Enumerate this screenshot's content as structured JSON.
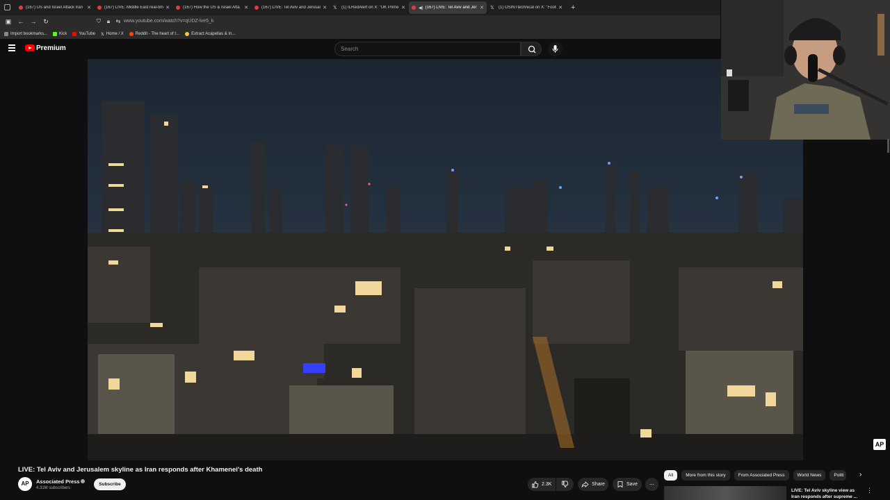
{
  "browser": {
    "tabs": [
      {
        "label": "(167) US and Israel Attack Iran",
        "active": false
      },
      {
        "label": "(167) LIVE: Middle East real-tim",
        "active": false
      },
      {
        "label": "(167) How the US & Israel Atta",
        "active": false
      },
      {
        "label": "(167) LIVE: Tel Aviv and Jerusale",
        "active": false
      },
      {
        "label": "(1) ILRedAlert on X: \"UK Prime",
        "active": false
      },
      {
        "label": "(167) LIVE: Tel Aviv and Jer",
        "active": true
      },
      {
        "label": "(1) OSINTtechnical on X: \"Footi",
        "active": false
      }
    ],
    "new_tab": "+",
    "url": "www.youtube.com/watch?v=qUDZ-lve5_k",
    "bookmarks": [
      {
        "label": "Import bookmarks...",
        "color": "#888888"
      },
      {
        "label": "Kick",
        "color": "#53fc18"
      },
      {
        "label": "YouTube",
        "color": "#ff0000"
      },
      {
        "label": "Home / X",
        "color": "#ffffff"
      },
      {
        "label": "Reddit - The heart of t...",
        "color": "#ff4500"
      },
      {
        "label": "Extract Acapellas & In...",
        "color": "#f5c542"
      }
    ]
  },
  "youtube": {
    "brand": "Premium",
    "search_placeholder": "Search",
    "video": {
      "title": "LIVE: Tel Aviv and Jerusalem skyline as Iran responds after Khamenei's death",
      "watermark": "AP"
    },
    "channel": {
      "avatar_text": "AP",
      "name": "Associated Press",
      "subscribers": "4.31M subscribers",
      "subscribe_label": "Subscribe"
    },
    "actions": {
      "likes": "2.3K",
      "share": "Share",
      "save": "Save",
      "more": "⋯"
    },
    "chips": [
      "All",
      "More from this story",
      "From Associated Press",
      "World News",
      "Politi"
    ],
    "recommendation": {
      "title": "LIVE: Tel Aviv skyline view as Iran responds after supreme ..."
    }
  }
}
